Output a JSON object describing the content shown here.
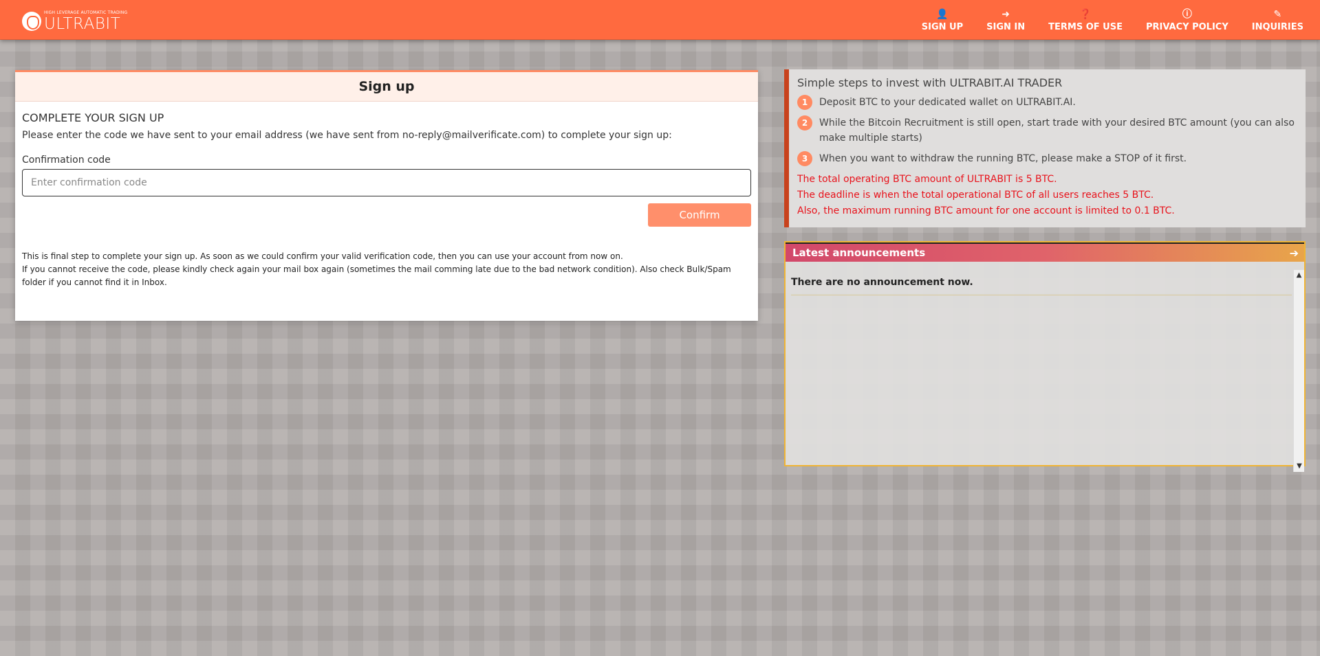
{
  "header": {
    "logo_tagline": "HIGH LEVERAGE AUTOMATIC TRADING",
    "logo_name": "ULTRABIT",
    "nav": [
      {
        "label": "SIGN UP",
        "icon": "user-plus-icon"
      },
      {
        "label": "SIGN IN",
        "icon": "sign-in-icon"
      },
      {
        "label": "TERMS OF USE",
        "icon": "question-icon"
      },
      {
        "label": "PRIVACY POLICY",
        "icon": "info-icon"
      },
      {
        "label": "INQUIRIES",
        "icon": "edit-icon"
      }
    ]
  },
  "signup": {
    "header": "Sign up",
    "title": "COMPLETE YOUR SIGN UP",
    "description": "Please enter the code we have sent to your email address (we have sent from no-reply@mailverificate.com) to complete your sign up:",
    "field_label": "Confirmation code",
    "placeholder": "Enter confirmation code",
    "value": "",
    "confirm_label": "Confirm",
    "note_1": "This is final step to complete your sign up. As soon as we could confirm your valid verification code, then you can use your account from now on.",
    "note_2": "If you cannot receive the code, please kindly check again your mail box again (sometimes the mail comming late due to the bad network condition). Also check Bulk/Spam folder if you cannot find it in Inbox."
  },
  "steps": {
    "title": "Simple steps to invest with ULTRABIT.AI TRADER",
    "items": [
      {
        "num": "1",
        "text": "Deposit BTC to your dedicated wallet on ULTRABIT.AI."
      },
      {
        "num": "2",
        "text": "While the Bitcoin Recruitment is still open, start trade with your desired BTC amount (you can also make multiple starts)"
      },
      {
        "num": "3",
        "text": "When you want to withdraw the running BTC, please make a STOP of it first."
      }
    ],
    "warnings": [
      "The total operating BTC amount of ULTRABIT is 5 BTC.",
      "The deadline is when the total operational BTC of all users reaches 5 BTC.",
      "Also, the maximum running BTC amount for one account is limited to 0.1 BTC."
    ]
  },
  "announcements": {
    "title": "Latest announcements",
    "empty_text": "There are no announcement now."
  },
  "colors": {
    "header": "#ff6a3f",
    "confirm_button": "#ff8f6b",
    "steps_accent": "#c8421d",
    "warning_text": "#e8121b",
    "announcement_border": "#f0b433"
  }
}
